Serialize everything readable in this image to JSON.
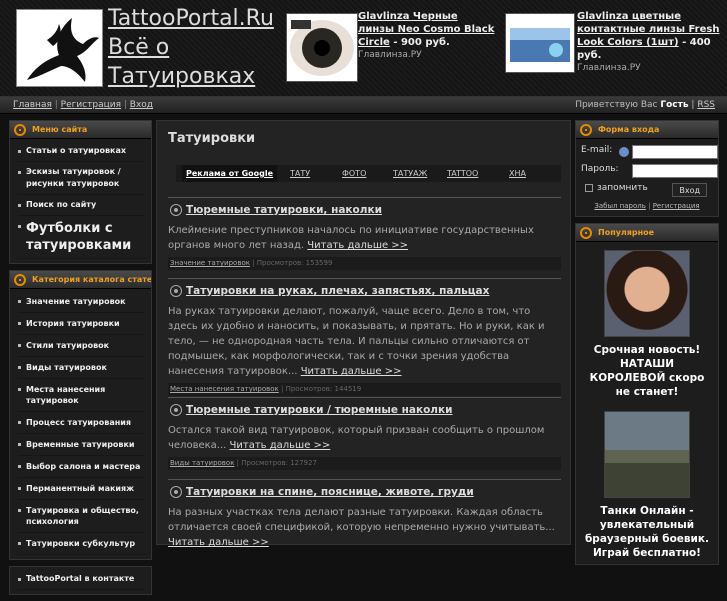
{
  "site": {
    "title": "TattooPortal.Ru Всё о Татуировках"
  },
  "ads": [
    {
      "title": "Glavlinza Черные линзы Neo Cosmo Black Circle",
      "price": "- 900 руб.",
      "source": "Главлинза.РУ"
    },
    {
      "title": "Glavlinza цветные контактные линзы Fresh Look Colors (1шт)",
      "price": "- 400 руб.",
      "source": "Главлинза.РУ"
    }
  ],
  "nav": {
    "home": "Главная",
    "register": "Регистрация",
    "login": "Вход",
    "greeting": "Приветствую Вас",
    "user": "Гость",
    "rss": "RSS"
  },
  "site_menu": {
    "title": "Меню сайта",
    "items": [
      "Статьи о татуировках",
      "Эскизы татуировок / рисунки татуировок",
      "Поиск по сайту",
      "Футболки с татуировками"
    ]
  },
  "catalog": {
    "title": "Категория каталога статей",
    "items": [
      "Значение татуировок",
      "История татуировки",
      "Стили татуировок",
      "Виды татуировок",
      "Места нанесения татуировок",
      "Процесс татуирования",
      "Временные татуировки",
      "Выбор салона и мастера",
      "Перманентный макияж",
      "Татуировка и общество, психология",
      "Татуировки субкультур"
    ]
  },
  "contact_box": {
    "title": "TattooPortal в контакте"
  },
  "main": {
    "title": "Татуировки",
    "google_bar": [
      "Реклама от Google",
      "ТАТУ",
      "ФОТО",
      "ТАТУАЖ",
      "TATTOO",
      "ХНА"
    ],
    "articles": [
      {
        "title": "Тюремные татуировки, наколки",
        "text": "Клеймение преступников началось по инициативе государственных органов много лет назад.",
        "more": "Читать дальше >>",
        "category": "Значение татуировок",
        "views": "Просмотров: 153599"
      },
      {
        "title": "Татуировки на руках, плечах, запястьях, пальцах",
        "text": "На руках татуировки делают, пожалуй, чаще всего. Дело в том, что здесь их удобно и наносить, и показывать, и прятать. Но и руки, как и тело, — не однородная часть тела. И пальцы сильно отличаются от подмышек, как морфологически, так и с точки зрения удобства нанесения татуировок...",
        "more": "Читать дальше >>",
        "category": "Места нанесения татуировок",
        "views": "Просмотров: 144519"
      },
      {
        "title": "Тюремные татуировки / тюремные наколки",
        "text": "Остался такой вид татуировок, который призван сообщить о прошлом человека...",
        "more": "Читать дальше >>",
        "category": "Виды татуировок",
        "views": "Просмотров: 127927"
      },
      {
        "title": "Татуировки на спине, пояснице, животе, груди",
        "text": "На разных участках тела делают разные татуировки. Каждая область отличается своей спецификой, которую непременно нужно учитывать...",
        "more": "Читать дальше >>",
        "category": "",
        "views": ""
      }
    ]
  },
  "login": {
    "title": "Форма входа",
    "email_label": "E-mail:",
    "password_label": "Пароль:",
    "remember": "запомнить",
    "submit": "Вход",
    "forgot": "Забыл пароль",
    "register": "Регистрация"
  },
  "popular": {
    "title": "Популярное",
    "items": [
      {
        "text": "Срочная новость! НАТАШИ КОРОЛЕВОЙ скоро не станет!"
      },
      {
        "text": "Танки Онлайн - увлекательный браузерный боевик. Играй бесплатно!"
      }
    ]
  }
}
